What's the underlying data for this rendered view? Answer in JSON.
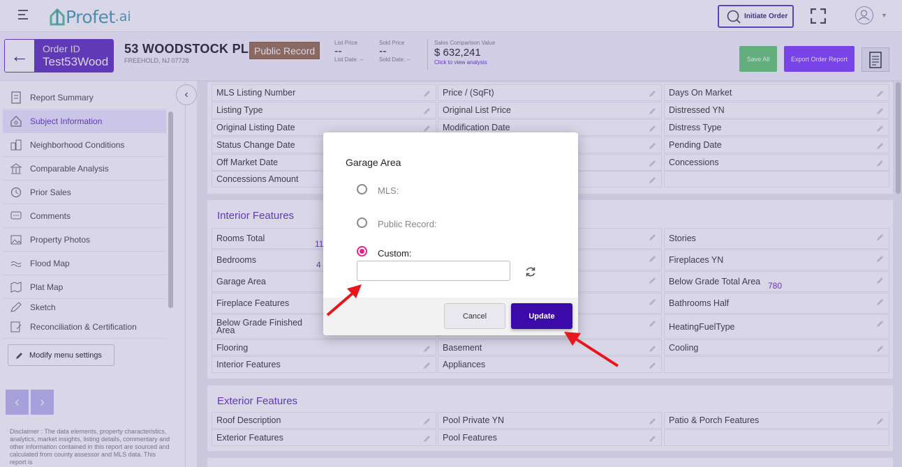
{
  "app": {
    "logo_name": "Profet",
    "logo_suffix": ".ai"
  },
  "topbar": {
    "initiate_label": "Initiate Order"
  },
  "header": {
    "order_id_label": "Order ID",
    "order_id_value": "Test53Wood",
    "address": "53 WOODSTOCK PL",
    "city": "FREEHOLD, NJ 07728",
    "badge": "Public Record",
    "list_price_label": "List Price",
    "list_price_value": "--",
    "list_date_label": "List Date: --",
    "sold_price_label": "Sold Price",
    "sold_price_value": "--",
    "sold_date_label": "Sold Date: --",
    "scv_label": "Sales Comparison Value",
    "scv_value": "$ 632,241",
    "scv_link": "Click to view analysis",
    "save_all": "Save All",
    "export": "Export Order Report"
  },
  "sidebar": {
    "items": [
      {
        "label": "Report Summary",
        "icon": "report-icon"
      },
      {
        "label": "Subject Information",
        "icon": "home-icon"
      },
      {
        "label": "Neighborhood Conditions",
        "icon": "city-icon"
      },
      {
        "label": "Comparable Analysis",
        "icon": "bank-icon"
      },
      {
        "label": "Prior Sales",
        "icon": "history-icon"
      },
      {
        "label": "Comments",
        "icon": "comment-icon"
      },
      {
        "label": "Property Photos",
        "icon": "photo-icon"
      },
      {
        "label": "Flood Map",
        "icon": "flood-icon"
      },
      {
        "label": "Plat Map",
        "icon": "map-icon"
      },
      {
        "label": "Sketch",
        "icon": "sketch-icon"
      },
      {
        "label": "Reconciliation & Certification",
        "icon": "certificate-icon"
      }
    ],
    "modify_label": "Modify menu settings",
    "disclaimer": "Disclaimer : The data elements, property characteristics, analytics, market insights, listing details, commentary and other information contained in this report are sourced and calculated from county assessor and MLS data. This report is"
  },
  "listing": {
    "rows": [
      [
        "MLS Listing Number",
        "Price / (SqFt)",
        "Days On Market"
      ],
      [
        "Listing Type",
        "Original List Price",
        "Distressed YN"
      ],
      [
        "Original Listing Date",
        "Modification Date",
        "Distress Type"
      ],
      [
        "Status Change Date",
        "",
        "Pending Date"
      ],
      [
        "Off Market Date",
        "",
        "Concessions"
      ],
      [
        "Concessions Amount",
        "",
        ""
      ]
    ]
  },
  "interior": {
    "title": "Interior Features",
    "rows": [
      [
        "Rooms Total",
        "",
        "Stories"
      ],
      [
        "Bedrooms",
        "",
        "Fireplaces YN"
      ],
      [
        "Garage Area",
        "",
        "Below Grade Total Area"
      ],
      [
        "Fireplace Features",
        "",
        "Bathrooms Half"
      ],
      [
        "Below Grade Finished Area",
        "",
        "HeatingFuelType"
      ],
      [
        "Flooring",
        "Basement",
        "Cooling"
      ],
      [
        "Interior Features",
        "Appliances",
        ""
      ]
    ],
    "values": {
      "rooms_total": "11",
      "bedrooms": "4",
      "below_grade_total": "780"
    }
  },
  "exterior": {
    "title": "Exterior Features",
    "rows": [
      [
        "Roof Description",
        "Pool Private YN",
        "Patio & Porch Features"
      ],
      [
        "Exterior Features",
        "Pool Features",
        ""
      ]
    ]
  },
  "modal": {
    "title": "Garage Area",
    "option_mls": "MLS:",
    "option_public": "Public Record:",
    "option_custom": "Custom:",
    "custom_value": "",
    "cancel": "Cancel",
    "update": "Update"
  },
  "colors": {
    "accent": "#6d40c5",
    "update_button": "#3c0aa8",
    "radio_selected": "#e0248a",
    "arrow": "#e8161b"
  }
}
